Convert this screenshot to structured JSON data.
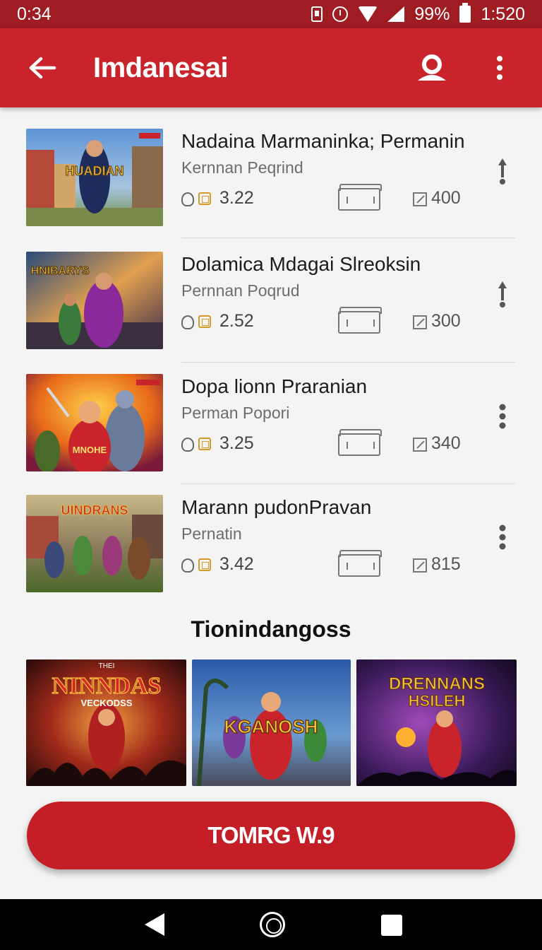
{
  "status_bar": {
    "time": "0:34",
    "battery": "99%",
    "clock_right": "1:520"
  },
  "app_bar": {
    "title": "Imdanesai",
    "back_icon": "arrow-left-icon",
    "account_icon": "account-icon",
    "menu_icon": "more-vert-icon"
  },
  "items": [
    {
      "title": "Nadaina Marmaninka; Permanin",
      "subtitle": "Kernnan Peqrind",
      "rating": "3.22",
      "count": "400",
      "action": "arrow-up-icon",
      "thumb_caption": "HUADIAN"
    },
    {
      "title": "Dolamica Mdagai Slreoksin",
      "subtitle": "Pernnan Poqrud",
      "rating": "2.52",
      "count": "300",
      "action": "arrow-up-icon",
      "thumb_caption": "HNIBARYS"
    },
    {
      "title": "Dopa lionn Praranian",
      "subtitle": "Perman Popori",
      "rating": "3.25",
      "count": "340",
      "action": "more-vert-icon",
      "thumb_caption": "MNOHE"
    },
    {
      "title": "Marann pudonPravan",
      "subtitle": "Pernatin",
      "rating": "3.42",
      "count": "815",
      "action": "more-vert-icon",
      "thumb_caption": "UINDRANS"
    }
  ],
  "trending": {
    "title": "Tionindangoss",
    "tiles": [
      {
        "caption": "NINNDAS",
        "subcaption": "VECKODSS",
        "top": "THEI"
      },
      {
        "caption": "KGANOSH",
        "subcaption": "",
        "top": ""
      },
      {
        "caption": "DRENNANS",
        "subcaption": "HSILEH",
        "top": ""
      }
    ]
  },
  "primary_button": {
    "label": "TOMRG W.9"
  },
  "colors": {
    "brand": "#c9242b",
    "status": "#9e1c22",
    "accent": "#d69a2a"
  }
}
